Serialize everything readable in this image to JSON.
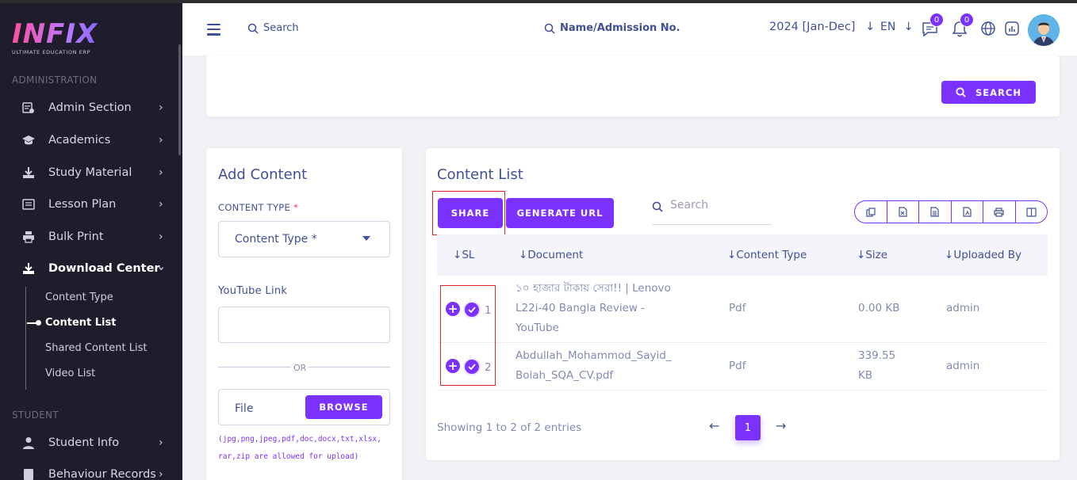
{
  "brand": {
    "logo_text": "INFIX",
    "tagline": "ULTIMATE EDUCATION ERP"
  },
  "sidebar": {
    "section_admin": "ADMINISTRATION",
    "items": [
      {
        "label": "Admin Section"
      },
      {
        "label": "Academics"
      },
      {
        "label": "Study Material"
      },
      {
        "label": "Lesson Plan"
      },
      {
        "label": "Bulk Print"
      },
      {
        "label": "Download Center"
      }
    ],
    "sub_items": [
      {
        "label": "Content Type"
      },
      {
        "label": "Content List"
      },
      {
        "label": "Shared Content List"
      },
      {
        "label": "Video List"
      }
    ],
    "section_student": "STUDENT",
    "student_items": [
      {
        "label": "Student Info"
      },
      {
        "label": "Behaviour Records"
      }
    ]
  },
  "header": {
    "search_label": "Search",
    "name_search_label": "Name/Admission No.",
    "year": "2024 [Jan-Dec]",
    "lang": "EN",
    "chat_badge": "0",
    "notif_badge": "0"
  },
  "top_panel": {
    "search_button": "SEARCH"
  },
  "add_content": {
    "title": "Add Content",
    "content_type_label": "CONTENT TYPE",
    "required_mark": "*",
    "content_type_placeholder": "Content Type *",
    "youtube_label": "YouTube Link",
    "or_text": "OR",
    "file_label": "File",
    "browse_button": "BROWSE",
    "allowed_line1": "(jpg,png,jpeg,pdf,doc,docx,txt,xlsx,",
    "allowed_line2": "rar,zip are allowed for upload)"
  },
  "content_list": {
    "title": "Content List",
    "share_button": "SHARE",
    "generate_button": "GENERATE URL",
    "search_placeholder": "Search",
    "columns": [
      "SL",
      "Document",
      "Content Type",
      "Size",
      "Uploaded By"
    ],
    "rows": [
      {
        "sl": "1",
        "doc_lines": [
          "১০ হাজার টাকায় সেরা!! | Lenovo",
          "L22i-40 Bangla Review -",
          "YouTube"
        ],
        "type": "Pdf",
        "size_lines": [
          "0.00 KB"
        ],
        "by": "admin"
      },
      {
        "sl": "2",
        "doc_lines": [
          "Abdullah_Mohammod_Sayid_",
          "Boiah_SQA_CV.pdf"
        ],
        "type": "Pdf",
        "size_lines": [
          "339.55",
          "KB"
        ],
        "by": "admin"
      }
    ],
    "showing": "Showing 1 to 2 of 2 entries",
    "page": "1"
  },
  "colors": {
    "accent": "#7c32ff",
    "sidebar_bg": "#1f1d2b",
    "text": "#415094",
    "highlight": "#e0282b"
  }
}
